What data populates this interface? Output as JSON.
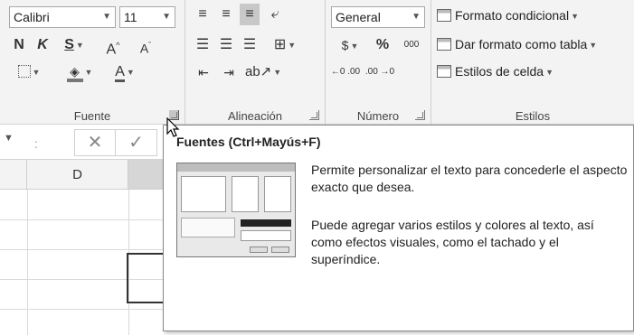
{
  "font_group": {
    "font_name": "Calibri",
    "font_size": "11",
    "bold_label": "N",
    "italic_label": "K",
    "underline_label": "S",
    "grow_label": "A",
    "shrink_label": "A",
    "color_label": "A",
    "label": "Fuente"
  },
  "alignment_group": {
    "label": "Alineación"
  },
  "number_group": {
    "format": "General",
    "percent_label": "%",
    "thousands_label": "000",
    "increase_decimal_label": "←0 .00",
    "decrease_decimal_label": ".00 →0",
    "label": "Número"
  },
  "styles_group": {
    "conditional_format": "Formato condicional",
    "format_as_table": "Dar formato como tabla",
    "cell_styles": "Estilos de celda",
    "label": "Estilos"
  },
  "formula_bar": {
    "separator": ":",
    "cancel_symbol": "✕",
    "enter_symbol": "✓"
  },
  "grid": {
    "column_d": "D"
  },
  "tooltip": {
    "title": "Fuentes (Ctrl+Mayús+F)",
    "paragraph1": "Permite personalizar el texto para concederle el aspecto exacto que desea.",
    "paragraph2": "Puede agregar varios estilos y colores al texto, así como efectos visuales, como el tachado y el superíndice."
  },
  "colors": {
    "ribbon_bg": "#f3f3f3",
    "accent_gray": "#8a8a8a"
  }
}
